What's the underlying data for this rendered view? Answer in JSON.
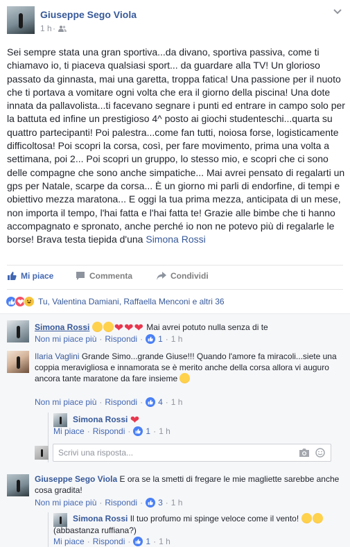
{
  "post": {
    "author": "Giuseppe Sego Viola",
    "time": "1 h",
    "separator": "·",
    "text_main": "Sei sempre stata una gran sportiva...da divano, sportiva passiva, come ti chiamavo io, ti piaceva qualsiasi sport... da guardare alla TV! Un glorioso passato da ginnasta, mai una garetta, troppa fatica! Una passione per il nuoto che ti portava a vomitare ogni volta che era il giorno della piscina! Una dote innata da pallavolista...ti facevano segnare i punti ed entrare in campo solo per la battuta ed infine un prestigioso 4^ posto ai giochi studenteschi...quarta su quattro partecipanti! Poi palestra...come fan tutti, noiosa forse, logisticamente difficoltosa! Poi scopri la corsa, così, per fare movimento, prima una volta a settimana, poi 2... Poi scopri un gruppo, lo stesso mio, e scopri che ci sono delle compagne che sono anche simpatiche... Mai avrei pensato di regalarti un gps per Natale, scarpe da corsa... È un giorno mi parli di endorfine, di tempi e obiettivo mezza maratona... E oggi la tua prima mezza, anticipata di un mese, non importa il tempo, l'hai fatta e l'hai fatta te! Grazie alle bimbe che ti hanno accompagnato e spronato, anche perché io non ne potevo più di regalarle le borse! Brava testa tiepida d'una ",
    "tagged_name": "Simona Rossi"
  },
  "actions": {
    "like": "Mi piace",
    "comment": "Commenta",
    "share": "Condividi"
  },
  "reactions": {
    "summary": "Tu, Valentina Damiani, Raffaella Menconi e altri 36"
  },
  "comments": [
    {
      "author": "Simona Rossi",
      "text": "Mai avrei potuto nulla senza di te",
      "unlike": "Non mi piace più",
      "reply": "Rispondi",
      "likes": "1",
      "time": "1 h"
    },
    {
      "author": "Ilaria Vaglini",
      "text": "Grande Simo...grande Giuse!!! Quando l'amore fa miracoli...siete una coppia meravigliosa e innamorata se è merito anche della corsa allora vi auguro ancora tante maratone da fare insieme",
      "unlike": "Non mi piace più",
      "reply": "Rispondi",
      "likes": "4",
      "time": "1 h",
      "replies": [
        {
          "author": "Simona Rossi",
          "text": "",
          "like": "Mi piace",
          "reply": "Rispondi",
          "likes": "1",
          "time": "1 h"
        }
      ]
    },
    {
      "author": "Giuseppe Sego Viola",
      "text": "E ora se la smetti di fregare le mie magliette sarebbe anche cosa gradita!",
      "unlike": "Non mi piace più",
      "reply": "Rispondi",
      "likes": "3",
      "time": "1 h",
      "replies": [
        {
          "author": "Simona Rossi",
          "text": "Il tuo profumo mi spinge veloce come il vento!",
          "text2": "(abbastanza ruffiana?)",
          "like": "Mi piace",
          "reply": "Rispondi",
          "likes": "1",
          "time": "1 h"
        }
      ]
    }
  ],
  "reply_box": {
    "placeholder": "Scrivi una risposta..."
  },
  "colors": {
    "link": "#365899",
    "accent": "#4267b2",
    "muted": "#90949c",
    "comments_bg": "#f6f7f9"
  }
}
